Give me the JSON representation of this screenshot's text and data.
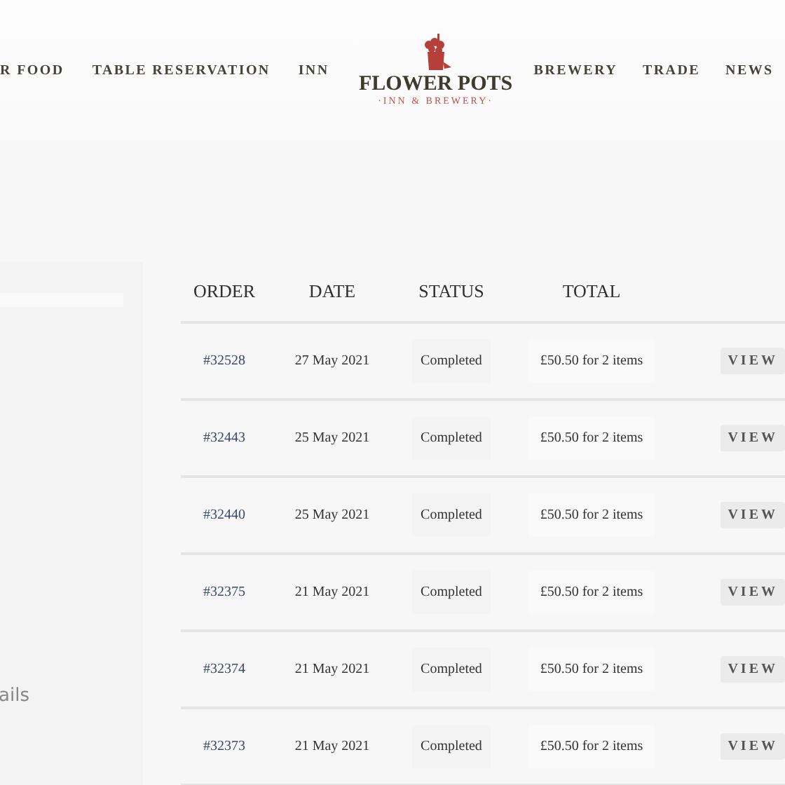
{
  "nav_left": [
    {
      "label": "R FOOD"
    },
    {
      "label": "TABLE RESERVATION"
    },
    {
      "label": "INN"
    }
  ],
  "logo": {
    "title": "FLOWER POTS",
    "subtitle": "·INN & BREWERY·"
  },
  "nav_right": [
    {
      "label": "BREWERY"
    },
    {
      "label": "TRADE"
    },
    {
      "label": "NEWS"
    }
  ],
  "sidebar": {
    "text": "ails"
  },
  "table": {
    "columns": [
      "ORDER",
      "DATE",
      "STATUS",
      "TOTAL"
    ],
    "rows": [
      {
        "order": "#32528",
        "date": "27 May 2021",
        "status": "Completed",
        "total": "£50.50 for 2 items",
        "action": "VIEW"
      },
      {
        "order": "#32443",
        "date": "25 May 2021",
        "status": "Completed",
        "total": "£50.50 for 2 items",
        "action": "VIEW"
      },
      {
        "order": "#32440",
        "date": "25 May 2021",
        "status": "Completed",
        "total": "£50.50 for 2 items",
        "action": "VIEW"
      },
      {
        "order": "#32375",
        "date": "21 May 2021",
        "status": "Completed",
        "total": "£50.50 for 2 items",
        "action": "VIEW"
      },
      {
        "order": "#32374",
        "date": "21 May 2021",
        "status": "Completed",
        "total": "£50.50 for 2 items",
        "action": "VIEW"
      },
      {
        "order": "#32373",
        "date": "21 May 2021",
        "status": "Completed",
        "total": "£50.50 for 2 items",
        "action": "VIEW"
      }
    ]
  }
}
